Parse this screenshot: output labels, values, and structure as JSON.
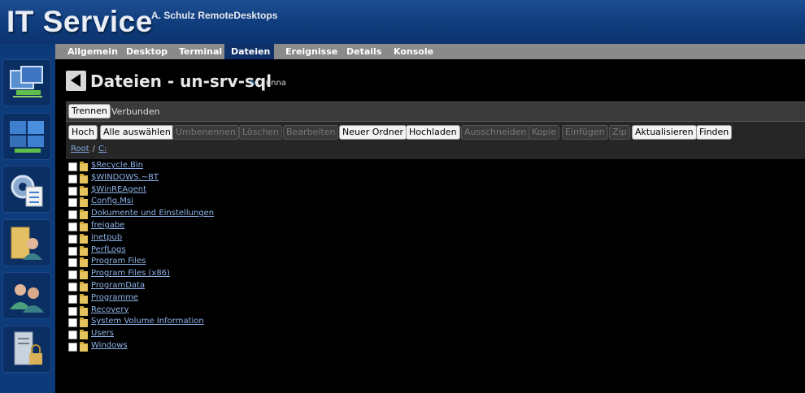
{
  "header": {
    "title": "IT Service",
    "subtitle": "A. Schulz RemoteDesktops"
  },
  "sidebar": {
    "items": [
      {
        "icon": "remote-computers-icon"
      },
      {
        "icon": "windows-computers-icon"
      },
      {
        "icon": "settings-checklist-icon"
      },
      {
        "icon": "user-folder-icon"
      },
      {
        "icon": "users-icon"
      },
      {
        "icon": "server-lock-icon"
      }
    ]
  },
  "tabs": [
    {
      "label": "Allgemein",
      "active": false
    },
    {
      "label": "Desktop",
      "active": false
    },
    {
      "label": "Terminal",
      "active": false
    },
    {
      "label": "Dateien",
      "active": true
    },
    {
      "label": "Ereignisse",
      "active": false
    },
    {
      "label": "Details",
      "active": false
    },
    {
      "label": "Konsole",
      "active": false
    }
  ],
  "page": {
    "title": "Dateien - un-srv-sql",
    "subtitle": "- unna"
  },
  "connection": {
    "disconnect_label": "Trennen",
    "status": "Verbunden"
  },
  "toolbar": {
    "buttons": [
      {
        "label": "Hoch",
        "enabled": true
      },
      {
        "label": "Alle auswählen",
        "enabled": true
      },
      {
        "label": "Umbenennen",
        "enabled": false
      },
      {
        "label": "Löschen",
        "enabled": false
      },
      {
        "label": "Bearbeiten",
        "enabled": false
      },
      {
        "label": "Neuer Ordner",
        "enabled": true
      },
      {
        "label": "Hochladen",
        "enabled": true
      },
      {
        "label": "Ausschneiden",
        "enabled": false
      },
      {
        "label": "Kopie",
        "enabled": false
      },
      {
        "label": "Einfügen",
        "enabled": false
      },
      {
        "label": "Zip",
        "enabled": false
      },
      {
        "label": "Aktualisieren",
        "enabled": true
      },
      {
        "label": "Finden",
        "enabled": true
      }
    ]
  },
  "breadcrumb": {
    "root": "Root",
    "separator": "/",
    "current": "C:"
  },
  "files": [
    "$Recycle.Bin",
    "$WINDOWS.~BT",
    "$WinREAgent",
    "Config.Msi",
    "Dokumente und Einstellungen",
    "freigabe",
    "inetpub",
    "PerfLogs",
    "Program Files",
    "Program Files (x86)",
    "ProgramData",
    "Programme",
    "Recovery",
    "System Volume Information",
    "Users",
    "Windows"
  ],
  "colors": {
    "header": "#0f3c7c",
    "tabbar": "#8a8a8a",
    "active_tab": "#10306a",
    "link": "#8db3e8",
    "folder": "#e6c35c"
  }
}
